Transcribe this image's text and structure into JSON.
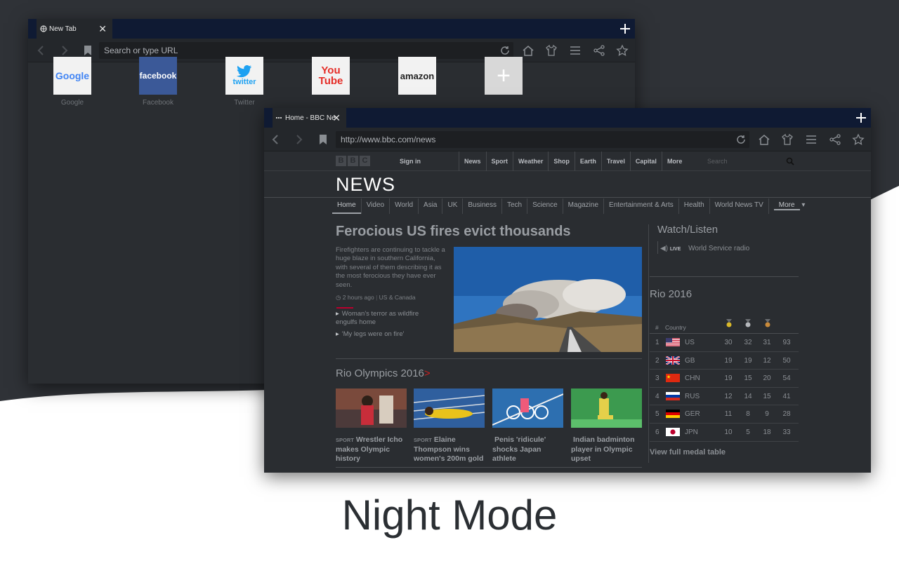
{
  "caption": "Night Mode",
  "back_window": {
    "tab_title": "New Tab",
    "url_placeholder": "Search or type URL",
    "tiles": [
      {
        "name": "google",
        "label": "Google",
        "logo_text": "Google"
      },
      {
        "name": "facebook",
        "label": "Facebook",
        "logo_text": "facebook"
      },
      {
        "name": "twitter",
        "label": "Twitter",
        "logo_text": "twitter"
      },
      {
        "name": "youtube",
        "label": "",
        "logo_text": "You Tube"
      },
      {
        "name": "amazon",
        "label": "",
        "logo_text": "amazon"
      },
      {
        "name": "add",
        "label": "",
        "logo_text": "+"
      }
    ]
  },
  "front_window": {
    "tab_title": "Home - BBC Ne",
    "url": "http://www.bbc.com/news",
    "bbc": {
      "logo_letters": [
        "B",
        "B",
        "C"
      ],
      "sign_in": "Sign in",
      "nav": [
        "News",
        "Sport",
        "Weather",
        "Shop",
        "Earth",
        "Travel",
        "Capital",
        "More"
      ],
      "search_placeholder": "Search",
      "news_title": "NEWS",
      "subnav": [
        "Home",
        "Video",
        "World",
        "Asia",
        "UK",
        "Business",
        "Tech",
        "Science",
        "Magazine",
        "Entertainment & Arts",
        "Health",
        "World News TV",
        "More"
      ],
      "top_story": {
        "headline": "Ferocious US fires evict thousands",
        "summary": "Firefighters are continuing to tackle a huge blaze in southern California, with several of them describing it as the most ferocious they have ever seen.",
        "time": "2 hours ago",
        "section": "US & Canada",
        "related": [
          "Woman's terror as wildfire engulfs home",
          "'My legs were on fire'"
        ]
      },
      "rio_section_title": "Rio Olympics 2016",
      "rio_section_arrow": ">",
      "stories": [
        {
          "tag": "Sport",
          "text": "Wrestler Icho makes Olympic history"
        },
        {
          "tag": "Sport",
          "text": "Elaine Thompson wins women's 200m gold"
        },
        {
          "tag": "",
          "text": "Penis 'ridicule' shocks Japan athlete"
        },
        {
          "tag": "",
          "text": "Indian badminton player in Olympic upset"
        }
      ],
      "watch_title": "Watch/Listen",
      "live_badge": "LIVE",
      "live_text": "World Service radio",
      "rio_title": "Rio 2016",
      "medal_header": {
        "hash": "#",
        "country": "Country"
      },
      "medal_colors": [
        "#d9b82a",
        "#b5b8bc",
        "#c88a3a"
      ],
      "medals": [
        {
          "rank": "1",
          "country": "US",
          "gold": "30",
          "silver": "32",
          "bronze": "31",
          "total": "93"
        },
        {
          "rank": "2",
          "country": "GB",
          "gold": "19",
          "silver": "19",
          "bronze": "12",
          "total": "50"
        },
        {
          "rank": "3",
          "country": "CHN",
          "gold": "19",
          "silver": "15",
          "bronze": "20",
          "total": "54"
        },
        {
          "rank": "4",
          "country": "RUS",
          "gold": "12",
          "silver": "14",
          "bronze": "15",
          "total": "41"
        },
        {
          "rank": "5",
          "country": "GER",
          "gold": "11",
          "silver": "8",
          "bronze": "9",
          "total": "28"
        },
        {
          "rank": "6",
          "country": "JPN",
          "gold": "10",
          "silver": "5",
          "bronze": "18",
          "total": "33"
        }
      ],
      "full_medal_link": "View full medal table"
    }
  }
}
